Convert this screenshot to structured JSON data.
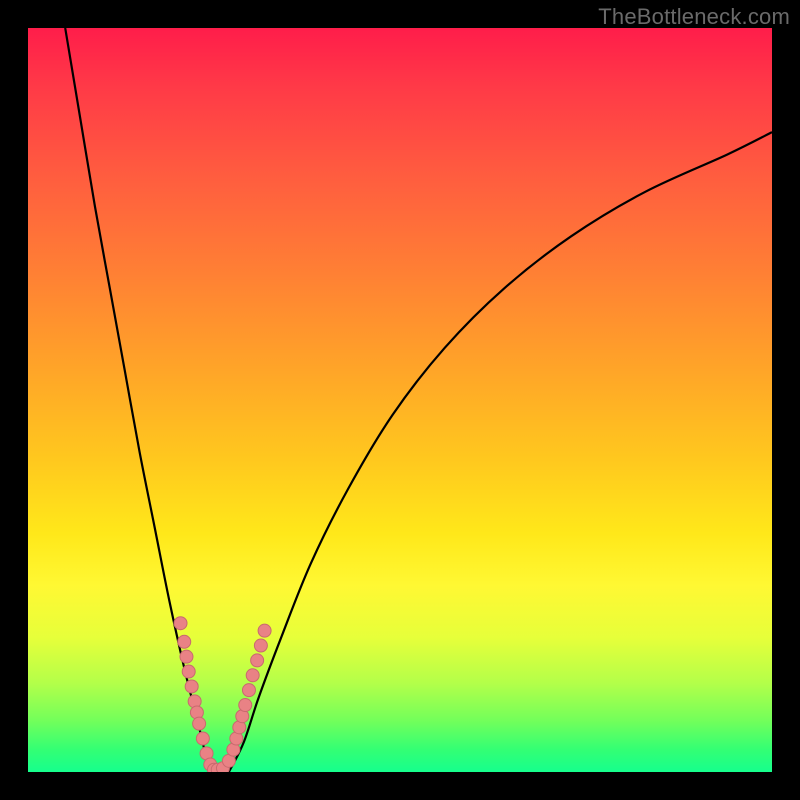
{
  "watermark": "TheBottleneck.com",
  "colors": {
    "frame": "#000000",
    "curve": "#000000",
    "points_fill": "#e98285",
    "points_stroke": "#c86a6e",
    "gradient_stops": [
      "#ff1d4a",
      "#ffe81a",
      "#16ff8d"
    ]
  },
  "chart_data": {
    "type": "line",
    "title": "",
    "xlabel": "",
    "ylabel": "",
    "xlim": [
      0,
      100
    ],
    "ylim": [
      0,
      100
    ],
    "note": "No axis ticks or numeric labels are rendered; x and y ranges are inferred as 0–100 percent of the plot area. y is the vertical height of the curve above the bottom edge.",
    "series": [
      {
        "name": "left-branch",
        "x": [
          5,
          7,
          9,
          11,
          13,
          15,
          17,
          19,
          21,
          23,
          24,
          25
        ],
        "y": [
          100,
          88,
          76,
          65,
          54,
          43,
          33,
          23,
          14,
          6,
          2,
          0
        ]
      },
      {
        "name": "right-branch",
        "x": [
          27,
          29,
          31,
          34,
          38,
          43,
          49,
          56,
          64,
          73,
          83,
          94,
          100
        ],
        "y": [
          0,
          4,
          10,
          18,
          28,
          38,
          48,
          57,
          65,
          72,
          78,
          83,
          86
        ]
      }
    ],
    "scatter_points": {
      "name": "highlighted-points",
      "x": [
        20.5,
        21.0,
        21.3,
        21.6,
        22.0,
        22.4,
        22.7,
        23.0,
        23.5,
        24.0,
        24.5,
        25.0,
        25.5,
        26.2,
        27.0,
        27.6,
        28.0,
        28.4,
        28.8,
        29.2,
        29.7,
        30.2,
        30.8,
        31.3,
        31.8
      ],
      "y": [
        20.0,
        17.5,
        15.5,
        13.5,
        11.5,
        9.5,
        8.0,
        6.5,
        4.5,
        2.5,
        1.0,
        0.3,
        0.3,
        0.5,
        1.5,
        3.0,
        4.5,
        6.0,
        7.5,
        9.0,
        11.0,
        13.0,
        15.0,
        17.0,
        19.0
      ]
    }
  }
}
